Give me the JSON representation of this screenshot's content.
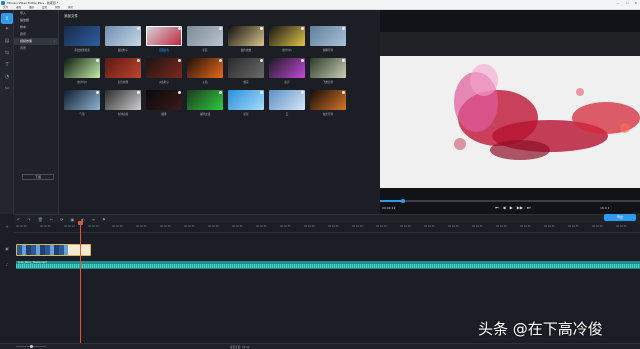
{
  "window": {
    "title": "Movavi Video Editor Plus - 新项目 *",
    "controls": [
      "—",
      "☐",
      "✕"
    ]
  },
  "menu": [
    "文件",
    "编辑",
    "播放",
    "设置",
    "帮助",
    "购买"
  ],
  "tools": [
    {
      "icon": "import-icon",
      "glyph": "⇧",
      "active": true
    },
    {
      "icon": "magic-wand-icon",
      "glyph": "✦",
      "active": false
    },
    {
      "icon": "filter-icon",
      "glyph": "▤",
      "active": false
    },
    {
      "icon": "transition-icon",
      "glyph": "⇆",
      "active": false
    },
    {
      "icon": "titles-icon",
      "glyph": "T",
      "active": false
    },
    {
      "icon": "stickers-icon",
      "glyph": "◔",
      "active": false
    },
    {
      "icon": "more-tools-icon",
      "glyph": "✂",
      "active": false
    }
  ],
  "categories": [
    {
      "label": "导入",
      "active": false
    },
    {
      "label": "播放器",
      "active": false
    },
    {
      "label": "样本",
      "active": false
    },
    {
      "label": "音乐",
      "active": false
    },
    {
      "label": "视频效果",
      "active": true
    },
    {
      "label": "背景",
      "active": false
    }
  ],
  "save_button": "下载",
  "effects_panel": {
    "heading": "添加文件",
    "tiles": [
      {
        "label": "添加效果搜索",
        "colors": [
          "#1a2a4a",
          "#2d5fa0"
        ],
        "download": false,
        "selected": false
      },
      {
        "label": "魔法粒子",
        "colors": [
          "#6f8fb0",
          "#c8d7e6"
        ],
        "download": true,
        "selected": false
      },
      {
        "label": "花瓣颜色",
        "colors": [
          "#d8d8de",
          "#c0233a"
        ],
        "download": true,
        "selected": true
      },
      {
        "label": "星辰",
        "colors": [
          "#7c8a97",
          "#b8c4cf"
        ],
        "download": true,
        "selected": false
      },
      {
        "label": "胶片倒数",
        "colors": [
          "#111111",
          "#d9c48a"
        ],
        "download": true,
        "selected": false
      },
      {
        "label": "倒计时5",
        "colors": [
          "#141414",
          "#e2c34b"
        ],
        "download": true,
        "selected": false
      },
      {
        "label": "烟雾背景",
        "colors": [
          "#5f7f9b",
          "#a9c2d6"
        ],
        "download": true,
        "selected": false
      },
      {
        "label": "倒计时9",
        "colors": [
          "#0e1a12",
          "#c4f0a8"
        ],
        "download": true,
        "selected": false
      },
      {
        "label": "红色纹理",
        "colors": [
          "#5a1a14",
          "#c0442e"
        ],
        "download": true,
        "selected": false
      },
      {
        "label": "火焰粒子",
        "colors": [
          "#1c1412",
          "#7a2a1c"
        ],
        "download": true,
        "selected": false
      },
      {
        "label": "火焰",
        "colors": [
          "#20110b",
          "#e66a1c"
        ],
        "download": true,
        "selected": false
      },
      {
        "label": "烟花",
        "colors": [
          "#2a2a2a",
          "#6b6b6b"
        ],
        "download": true,
        "selected": false
      },
      {
        "label": "彩光",
        "colors": [
          "#1a1a22",
          "#c44ad6"
        ],
        "download": true,
        "selected": false
      },
      {
        "label": "飞舞钞票",
        "colors": [
          "#2c3a2a",
          "#c9cfb4"
        ],
        "download": true,
        "selected": false
      },
      {
        "label": "气泡",
        "colors": [
          "#0e1c2e",
          "#8fb5d6"
        ],
        "download": true,
        "selected": false
      },
      {
        "label": "时钟齿轮",
        "colors": [
          "#2b2b2b",
          "#cfcfcf"
        ],
        "download": true,
        "selected": false
      },
      {
        "label": "烟雾",
        "colors": [
          "#0a0a0a",
          "#3a1a1a"
        ],
        "download": true,
        "selected": false
      },
      {
        "label": "绿屏过渡",
        "colors": [
          "#1e3a1e",
          "#2ecc40"
        ],
        "download": true,
        "selected": false
      },
      {
        "label": "星星",
        "colors": [
          "#2a8fd8",
          "#a6dcff"
        ],
        "download": true,
        "selected": false
      },
      {
        "label": "云",
        "colors": [
          "#5d8fc7",
          "#d6e7f6"
        ],
        "download": true,
        "selected": false
      },
      {
        "label": "烛光背景",
        "colors": [
          "#140c08",
          "#d7772a"
        ],
        "download": true,
        "selected": false
      }
    ]
  },
  "preview": {
    "timecode": "00:00:12",
    "transport": [
      "⏮",
      "◀",
      "▶",
      "▶▶",
      "⏭"
    ],
    "zoom": "16:9 ▾",
    "progress_fraction": 0.09
  },
  "timeline": {
    "toolbar": [
      "↶",
      "↷",
      "🗑",
      "✂",
      "⟳",
      "▣",
      "◐",
      "≡",
      "⚑"
    ],
    "export_label": "导出",
    "ruler": [
      "00:00:00",
      "00:00:05",
      "00:00:10",
      "00:00:15",
      "00:00:20",
      "00:00:25",
      "00:00:30",
      "00:00:35",
      "00:00:40",
      "00:00:45",
      "00:00:50",
      "00:00:55",
      "00:01:00",
      "00:01:05",
      "00:01:10",
      "00:01:15",
      "00:01:20",
      "00:01:25",
      "00:01:30",
      "00:01:35",
      "00:01:40",
      "00:01:45",
      "00:01:50",
      "00:01:55",
      "00:02:00",
      "00:02:05"
    ],
    "audio_label": "Love_Story_Theme.mp3"
  },
  "status": {
    "duration": "项目长度: 00:42"
  },
  "watermark": "头条 @在下高冷俊"
}
